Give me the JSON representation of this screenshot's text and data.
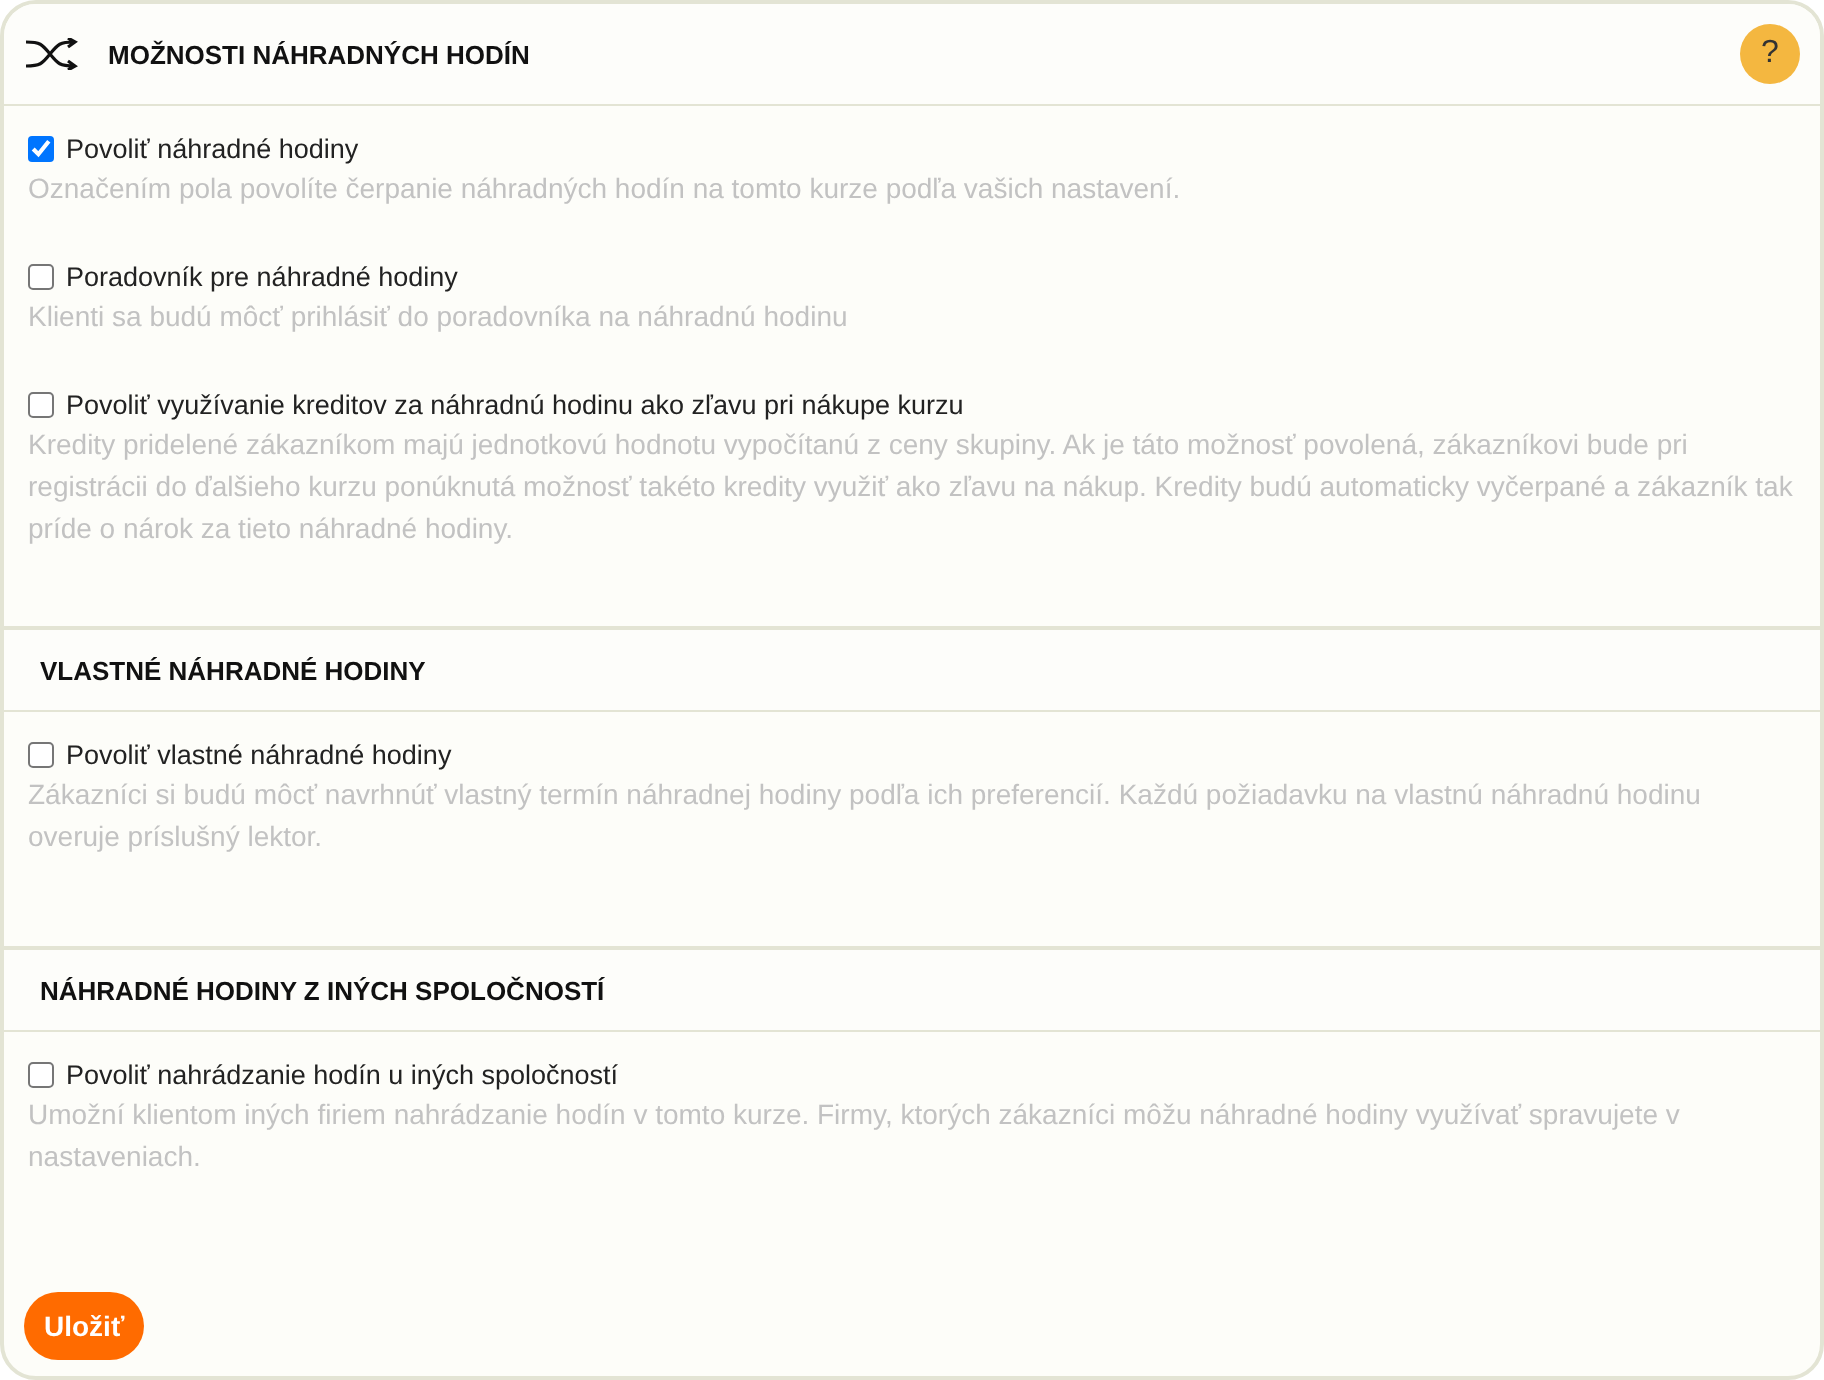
{
  "sections": [
    {
      "title": "MOŽNOSTI NÁHRADNÝCH HODÍN",
      "shuffle_icon": true,
      "help": "?",
      "options": [
        {
          "label": "Povoliť náhradné hodiny",
          "checked": true,
          "description": "Označením pola povolíte čerpanie náhradných hodín na tomto kurze podľa vašich nastavení."
        },
        {
          "label": "Poradovník pre náhradné hodiny",
          "checked": false,
          "description": "Klienti sa budú môcť prihlásiť do poradovníka na náhradnú hodinu"
        },
        {
          "label": "Povoliť využívanie kreditov za náhradnú hodinu ako zľavu pri nákupe kurzu",
          "checked": false,
          "description": "Kredity pridelené zákazníkom majú jednotkovú hodnotu vypočítanú z ceny skupiny. Ak je táto možnosť povolená, zákazníkovi bude pri registrácii do ďalšieho kurzu ponúknutá možnosť takéto kredity využiť ako zľavu na nákup. Kredity budú automaticky vyčerpané a zákazník tak príde o nárok za tieto náhradné hodiny."
        }
      ]
    },
    {
      "title": "VLASTNÉ NÁHRADNÉ HODINY",
      "shuffle_icon": false,
      "options": [
        {
          "label": "Povoliť vlastné náhradné hodiny",
          "checked": false,
          "description": "Zákazníci si budú môcť navrhnúť vlastný termín náhradnej hodiny podľa ich preferencií. Každú požiadavku na vlastnú náhradnú hodinu overuje príslušný lektor."
        }
      ]
    },
    {
      "title": "NÁHRADNÉ HODINY Z INÝCH SPOLOČNOSTÍ",
      "shuffle_icon": false,
      "options": [
        {
          "label": "Povoliť nahrádzanie hodín u iných spoločností",
          "checked": false,
          "description": "Umožní klientom iných firiem nahrádzanie hodín v tomto kurze. Firmy, ktorých zákazníci môžu náhradné hodiny využívať spravujete v nastaveniach."
        }
      ]
    }
  ],
  "save_button": "Uložiť"
}
